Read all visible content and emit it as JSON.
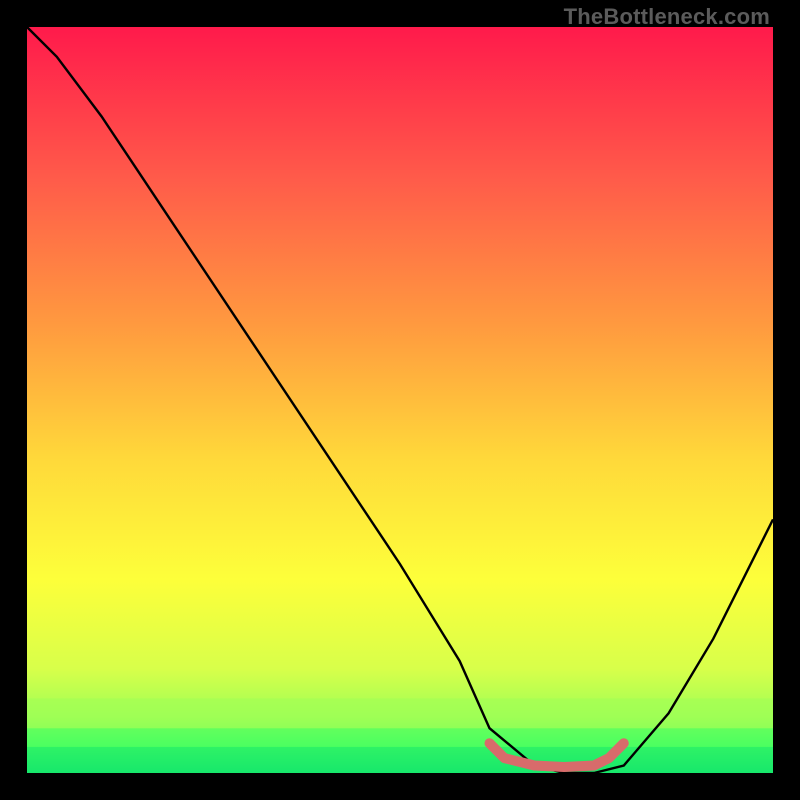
{
  "watermark": "TheBottleneck.com",
  "chart_data": {
    "type": "line",
    "title": "",
    "xlabel": "",
    "ylabel": "",
    "xlim": [
      0,
      100
    ],
    "ylim": [
      0,
      100
    ],
    "grid": false,
    "series": [
      {
        "name": "bottleneck-curve",
        "color": "#000000",
        "x": [
          0,
          4,
          10,
          20,
          30,
          40,
          50,
          58,
          62,
          68,
          72,
          76,
          80,
          86,
          92,
          100
        ],
        "y": [
          100,
          96,
          88,
          73,
          58,
          43,
          28,
          15,
          6,
          1,
          0,
          0,
          1,
          8,
          18,
          34
        ]
      }
    ],
    "highlight": {
      "name": "optimal-range",
      "color": "#d86b6b",
      "x": [
        62,
        64,
        68,
        72,
        76,
        78,
        80
      ],
      "y": [
        4,
        2,
        1,
        0.8,
        1,
        2,
        4
      ]
    },
    "background_gradient": {
      "stops": [
        {
          "offset": 0.0,
          "color": "#ff1a4b"
        },
        {
          "offset": 0.2,
          "color": "#ff5a4a"
        },
        {
          "offset": 0.4,
          "color": "#ff9a3f"
        },
        {
          "offset": 0.58,
          "color": "#ffd93a"
        },
        {
          "offset": 0.74,
          "color": "#fdff3a"
        },
        {
          "offset": 0.86,
          "color": "#d8ff4a"
        },
        {
          "offset": 0.925,
          "color": "#9fff55"
        },
        {
          "offset": 0.965,
          "color": "#4bff60"
        },
        {
          "offset": 1.0,
          "color": "#17e86b"
        }
      ]
    },
    "bottom_bands": [
      {
        "y": 0.965,
        "height": 0.035,
        "color": "#17e86b"
      },
      {
        "y": 0.94,
        "height": 0.025,
        "color": "#4bff60"
      },
      {
        "y": 0.9,
        "height": 0.04,
        "color": "#9fff55"
      }
    ]
  }
}
